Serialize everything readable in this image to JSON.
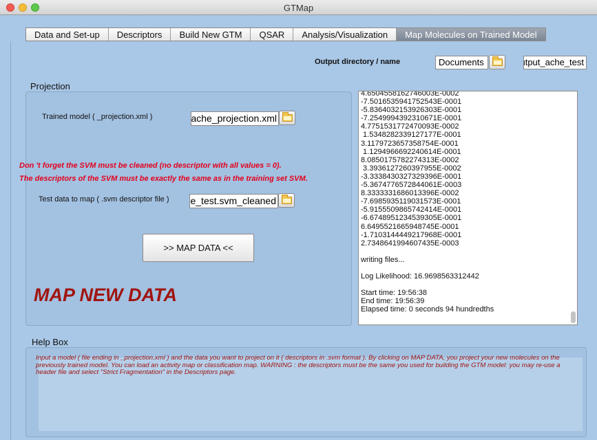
{
  "window": {
    "title": "GTMap"
  },
  "tabs": [
    {
      "label": "Data and Set-up",
      "active": false
    },
    {
      "label": "Descriptors",
      "active": false
    },
    {
      "label": "Build New GTM",
      "active": false
    },
    {
      "label": "QSAR",
      "active": false
    },
    {
      "label": "Analysis/Visualization",
      "active": false
    },
    {
      "label": "Map Molecules on Trained Model",
      "active": true
    }
  ],
  "output": {
    "label": "Output directory / name",
    "directory_value": "Documents",
    "name_value": "output_ache_test"
  },
  "projection": {
    "section_title": "Projection",
    "model_label": "Trained model ( _projection.xml )",
    "model_value": "ache_projection.xml",
    "warning_1": "Don 't forget the SVM must be cleaned (no descriptor with all values = 0).",
    "warning_2": "The descriptors of the SVM must be exactly the same as in the training set SVM.",
    "test_label": "Test data to map ( .svm descriptor file )",
    "test_value": "ache_test.svm_cleaned",
    "map_button": ">> MAP DATA <<",
    "big_title": "MAP NEW DATA"
  },
  "log": {
    "lines": [
      "4.6504558162746003E-0002",
      "-7.5016535941752543E-0001",
      "-5.8364032153926303E-0001",
      "-7.2549994392310671E-0001",
      "4.7751531772470093E-0002",
      " 1.5348282339127177E-0001",
      "3.1179723657358754E-0001",
      " 1.1294966692240614E-0001",
      "8.0850175782274313E-0002",
      " 3.3936127260397955E-0002",
      "-3.3338430327329396E-0001",
      "-5.3674776572844061E-0003",
      "8.3333331686013396E-0002",
      "-7.6985935119031573E-0001",
      "-5.9155509865742414E-0001",
      "-6.6748951234539305E-0001",
      "6.6495521665948745E-0001",
      "-1.7103144449217968E-0001",
      "2.7348641994607435E-0003",
      "",
      "writing files...",
      "",
      "Log Likelihood: 16.9698563312442",
      "",
      "Start time: 19:56:38",
      "End time: 19:56:39",
      "Elapsed time: 0 seconds 94 hundredths"
    ]
  },
  "help": {
    "section_title": "Help Box",
    "text": "Input a model ( file ending in _projection.xml  ) and the data you want to project on it ( descriptors in .svm format ). By clicking on MAP DATA, you project your new molecules on the previously trained model. You can load an activity map or classification map. WARNING : the descriptors must be the same you used for building the GTM model: you may re-use a header file and select \"Strict Fragmentation\" in the Descriptors page."
  },
  "icons": {
    "folder": "folder-icon"
  },
  "colors": {
    "background": "#a9c7e6",
    "warning": "#e4001b",
    "title_red": "#a0140f",
    "active_tab": "#8a94a2"
  }
}
